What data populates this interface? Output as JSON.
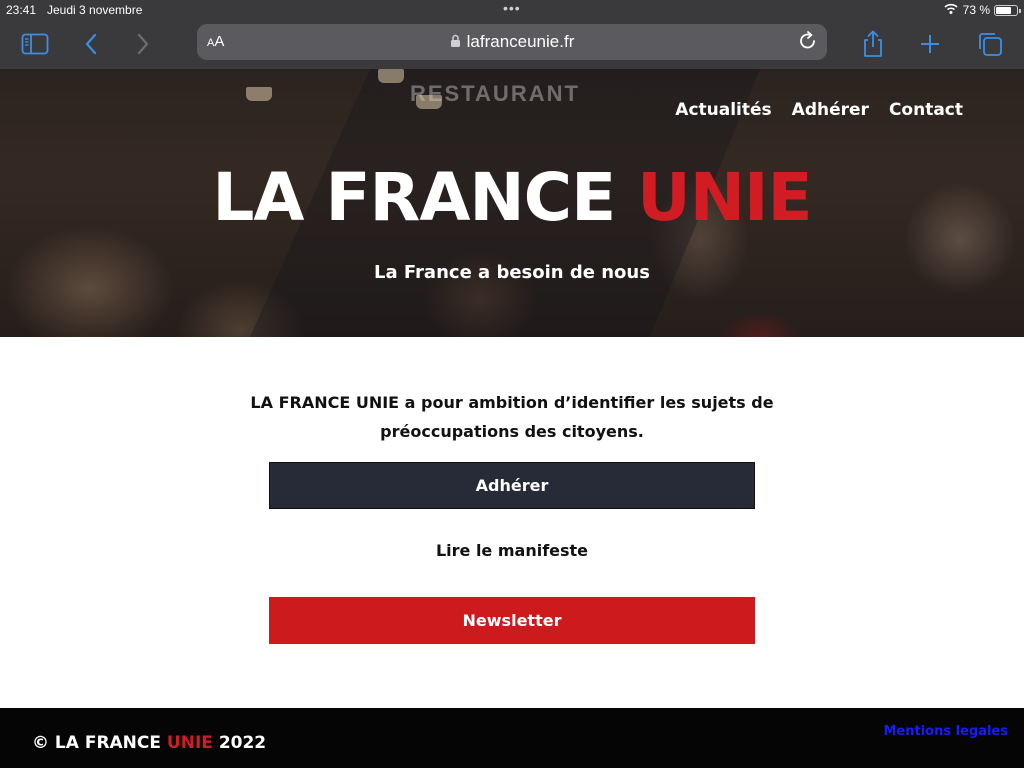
{
  "status_bar": {
    "time": "23:41",
    "date": "Jeudi 3 novembre",
    "battery_percent_label": "73 %",
    "battery_level": 0.73
  },
  "browser": {
    "text_size_label_small": "A",
    "text_size_label_large": "A",
    "url": "lafranceunie.fr",
    "icons": [
      "sidebar-icon",
      "back-icon",
      "forward-icon",
      "lock-icon",
      "reload-icon",
      "share-icon",
      "new-tab-icon",
      "tabs-icon"
    ]
  },
  "hero": {
    "background_sign": "RESTAURANT",
    "nav": [
      {
        "label": "Actualités"
      },
      {
        "label": "Adhérer"
      },
      {
        "label": "Contact"
      }
    ],
    "title_main": "LA FRANCE ",
    "title_accent": "UNIE",
    "subtitle": "La France a besoin de nous"
  },
  "main": {
    "intro": "LA FRANCE UNIE a pour ambition d’identifier les sujets de préoccupations des citoyens.",
    "adherer_button": "Adhérer",
    "manifeste_link": "Lire le manifeste",
    "newsletter_button": "Newsletter"
  },
  "footer": {
    "copyright_prefix": "© LA FRANCE ",
    "copyright_accent": "UNIE",
    "copyright_year": " 2022",
    "mentions_link": "Mentions legales"
  },
  "colors": {
    "brand_red": "#d21c23",
    "button_dark": "#272b37",
    "footer_bg": "#050505",
    "footer_link": "#1a1aff",
    "browser_chrome": "#3a3a3c",
    "browser_accent": "#3a8ee6"
  }
}
